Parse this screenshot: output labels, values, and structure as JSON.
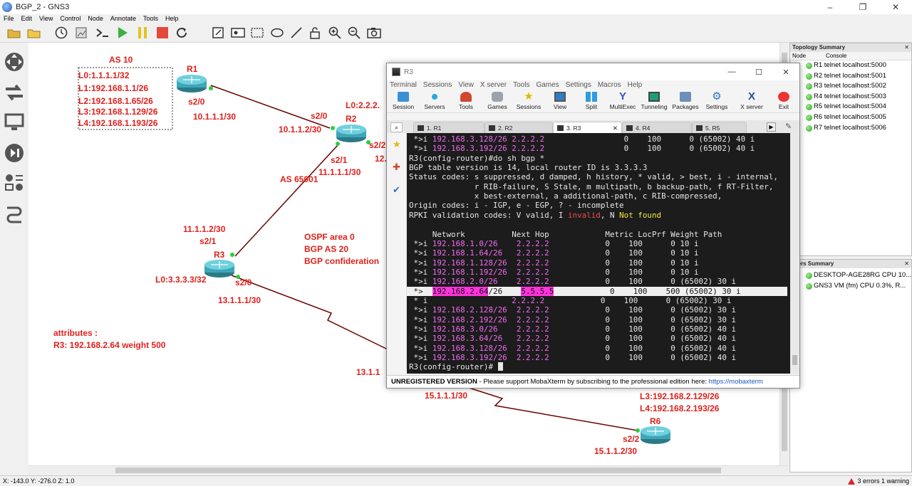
{
  "window": {
    "title": "BGP_2 - GNS3",
    "min": "–",
    "max": "❐",
    "close": "✕"
  },
  "menu": [
    "File",
    "Edit",
    "View",
    "Control",
    "Node",
    "Annotate",
    "Tools",
    "Help"
  ],
  "toolbar_icons": [
    "open-folder-icon",
    "folder-icon",
    "new-project-icon",
    "clock-icon",
    "snapshot-icon",
    "console-icon",
    "start-icon",
    "pause-icon",
    "stop-icon",
    "reload-icon",
    "note-icon",
    "image-icon",
    "rectangle-icon",
    "ellipse-icon",
    "line-icon",
    "lock-icon",
    "zoom-in-icon",
    "zoom-out-icon",
    "screenshot-icon"
  ],
  "left_tools": [
    "move-icon",
    "routers-icon",
    "end-devices-icon",
    "security-icon",
    "all-devices-icon",
    "link-icon"
  ],
  "topology": {
    "as10_title": "AS 10",
    "as10_box": [
      "L0:1.1.1.1/32",
      "L1:192.168.1.1/26",
      "L2:192.168.1.65/26",
      "L3:192.168.1.129/26",
      "L4:192.168.1.193/26"
    ],
    "r1": "R1",
    "r1_s20": "s2/0",
    "r1_net": "10.1.1.1/30",
    "r2": "R2",
    "r2_l0": "L0:2.2.2.",
    "r2_s20": "s2/0",
    "r2_net": "10.1.1.2/30",
    "r2_s21": "s2/1",
    "r2_net2": "11.1.1.1/30",
    "r2_s22": "s2/2",
    "r2_12": "12.",
    "as65001": "AS 65001",
    "r3": "R3",
    "r3_net1": "11.1.1.2/30",
    "r3_s21": "s2/1",
    "r3_l0": "L0:3.3.3.3/32",
    "r3_s20": "s2/0",
    "r3_net2": "13.1.1.1/30",
    "ospf": "OSPF area 0",
    "bgp_as": "BGP AS 20",
    "bgp_conf": "BGP confideration",
    "attr_title": "attributes :",
    "attr_line": "R3: 192.168.2.64 weight 500",
    "net13": "13.1.1",
    "net15": "15.1.1.1/30",
    "r6": "R6",
    "r6_s22": "s2/2",
    "r6_net": "15.1.1.2/30",
    "l3": "L3:192.168.2.129/26",
    "l4": "L4:192.168.2.193/26"
  },
  "topology_summary": {
    "title": "Topology Summary",
    "cols": [
      "Node",
      "Console"
    ],
    "rows": [
      {
        "name": "R1",
        "console": "telnet localhost:5000"
      },
      {
        "name": "R2",
        "console": "telnet localhost:5001"
      },
      {
        "name": "R3",
        "console": "telnet localhost:5002"
      },
      {
        "name": "R4",
        "console": "telnet localhost:5003"
      },
      {
        "name": "R5",
        "console": "telnet localhost:5004"
      },
      {
        "name": "R6",
        "console": "telnet localhost:5005"
      },
      {
        "name": "R7",
        "console": "telnet localhost:5006"
      }
    ]
  },
  "servers_summary": {
    "title": "rvers Summary",
    "rows": [
      "DESKTOP-AGE28RG CPU 10...",
      "GNS3 VM (fm) CPU 0.3%, R..."
    ]
  },
  "status": {
    "coords": "X: -143.0 Y: -276.0 Z: 1.0",
    "errors": "3 errors 1 warning"
  },
  "terminal": {
    "title": "R3",
    "min": "—",
    "max": "☐",
    "close": "✕",
    "menu": [
      "Terminal",
      "Sessions",
      "View",
      "X server",
      "Tools",
      "Games",
      "Settings",
      "Macros",
      "Help"
    ],
    "tools": [
      "Session",
      "Servers",
      "Tools",
      "Games",
      "Sessions",
      "View",
      "Split",
      "MultiExec",
      "Tunneling",
      "Packages",
      "Settings",
      "X server",
      "Exit"
    ],
    "tabs": [
      {
        "label": "1. R1",
        "active": false
      },
      {
        "label": "2. R2",
        "active": false
      },
      {
        "label": "3. R3",
        "active": true
      },
      {
        "label": "4. R4",
        "active": false
      },
      {
        "label": "5. R5",
        "active": false
      }
    ],
    "lines": {
      "l0a": " *>i ",
      "l0b": "192.168.3.128/26",
      "l0c": " 2.2.2.2",
      "l0d": "                 0    100      0 (65002) 40 i",
      "l1a": " *>i ",
      "l1b": "192.168.3.192/26",
      "l1c": " 2.2.2.2",
      "l1d": "                 0    100      0 (65002) 40 i",
      "l2": "R3(config-router)#do sh bgp *",
      "l3": "BGP table version is 14, local router ID is 3.3.3.3",
      "l4": "Status codes: s suppressed, d damped, h history, * valid, > best, i - internal,",
      "l5": "              r RIB-failure, S Stale, m multipath, b backup-path, f RT-Filter,",
      "l6": "              x best-external, a additional-path, c RIB-compressed,",
      "l7": "Origin codes: i - IGP, e - EGP, ? - incomplete",
      "l8a": "RPKI validation codes: V valid, I ",
      "l8b": "invalid",
      "l8c": ", N ",
      "l8d": "Not found",
      "l10": "     Network          Next Hop            Metric LocPrf Weight Path"
    },
    "routes": [
      {
        "flag": " *>i ",
        "net": "192.168.1.0",
        "mask": "/26   ",
        "hop": "2.2.2.2",
        "rest": "            0    100      0 10 i"
      },
      {
        "flag": " *>i ",
        "net": "192.168.1.64",
        "mask": "/26  ",
        "hop": "2.2.2.2",
        "rest": "            0    100      0 10 i"
      },
      {
        "flag": " *>i ",
        "net": "192.168.1.128",
        "mask": "/26 ",
        "hop": "2.2.2.2",
        "rest": "            0    100      0 10 i"
      },
      {
        "flag": " *>i ",
        "net": "192.168.1.192",
        "mask": "/26 ",
        "hop": "2.2.2.2",
        "rest": "            0    100      0 10 i"
      },
      {
        "flag": " *>i ",
        "net": "192.168.2.0",
        "mask": "/26   ",
        "hop": "2.2.2.2",
        "rest": "            0    100      0 (65002) 30 i"
      }
    ],
    "hl": {
      "flag": " *>  ",
      "net": "192.168.2.64",
      "mask": "/26   ",
      "hop": "5.5.5.5",
      "rest": "            0    100    500 (65002) 30 i"
    },
    "routes2": [
      {
        "flag": " * i ",
        "net": "",
        "mask": "                ",
        "hop": "2.2.2.2",
        "rest": "            0    100      0 (65002) 30 i"
      },
      {
        "flag": " *>i ",
        "net": "192.168.2.128",
        "mask": "/26 ",
        "hop": "2.2.2.2",
        "rest": "            0    100      0 (65002) 30 i"
      },
      {
        "flag": " *>i ",
        "net": "192.168.2.192",
        "mask": "/26 ",
        "hop": "2.2.2.2",
        "rest": "            0    100      0 (65002) 30 i"
      },
      {
        "flag": " *>i ",
        "net": "192.168.3.0",
        "mask": "/26   ",
        "hop": "2.2.2.2",
        "rest": "            0    100      0 (65002) 40 i"
      },
      {
        "flag": " *>i ",
        "net": "192.168.3.64",
        "mask": "/26  ",
        "hop": "2.2.2.2",
        "rest": "            0    100      0 (65002) 40 i"
      },
      {
        "flag": " *>i ",
        "net": "192.168.3.128",
        "mask": "/26 ",
        "hop": "2.2.2.2",
        "rest": "            0    100      0 (65002) 40 i"
      },
      {
        "flag": " *>i ",
        "net": "192.168.3.192",
        "mask": "/26 ",
        "hop": "2.2.2.2",
        "rest": "            0    100      0 (65002) 40 i"
      }
    ],
    "prompt": "R3(config-router)# ",
    "status_ver": "UNREGISTERED VERSION",
    "status_msg": "  -  Please support MobaXterm by subscribing to the professional edition here:  ",
    "status_link": "https://mobaxterm"
  }
}
